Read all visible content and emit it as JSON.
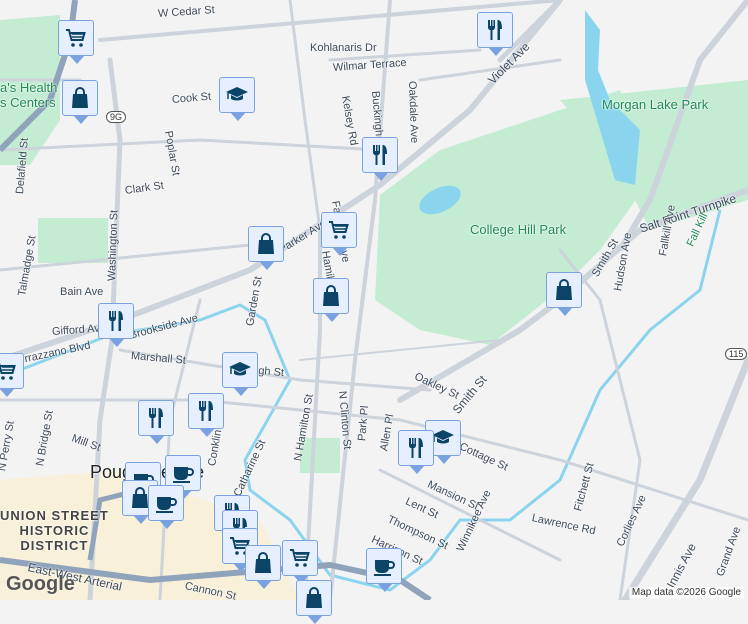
{
  "map": {
    "streets": [
      "W Cedar St",
      "Kohlanaris Dr",
      "Wilmar Terrace",
      "Cook St",
      "Poplar St",
      "Clark St",
      "Delafield St",
      "Washington St",
      "Talmadge St",
      "Bain Ave",
      "Gifford Ave",
      "Brookside Ave",
      "Verrazzano Blvd",
      "Marshall St",
      "Garden St",
      "Parker Ave",
      "N Hamilton St",
      "Fairview Ave",
      "Kelsey Rd",
      "Buckingham",
      "Oakdale Ave",
      "Violet Ave",
      "Salt Point Turnpike",
      "Smith St",
      "Hudson Ave",
      "Fallkill Ave",
      "Oakley St",
      "N Clinton St",
      "Park Pl",
      "Allen Pl",
      "Cottage St",
      "Mansion St",
      "Lent St",
      "Thompson St",
      "Harrison St",
      "Winnikee Ave",
      "Lawrence Rd",
      "Fitchett St",
      "Corlies Ave",
      "Innis Ave",
      "Grand Ave",
      "Mill St",
      "N Bridge St",
      "N Perry St",
      "Conklin St",
      "Catharine St",
      "East-West Arterial",
      "Cannon St",
      "Smith St",
      "Hamilton St",
      "High St"
    ],
    "places": {
      "morgan_lake": "Morgan Lake Park",
      "college_hill": "College Hill Park",
      "fall_kill": "Fall Kill",
      "health": "a's Health\ns Centers",
      "district": "UNION STREET\nHISTORIC\nDISTRICT",
      "city": "Poughkeepsie"
    },
    "route_shields": [
      "9G",
      "115"
    ],
    "markers": [
      "cart-icon",
      "bag-icon",
      "graduation-cap-icon",
      "restaurant-icon",
      "restaurant-icon",
      "cart-icon",
      "bag-icon",
      "bag-icon",
      "bag-icon",
      "restaurant-icon",
      "cart-icon",
      "graduation-cap-icon",
      "restaurant-icon",
      "restaurant-icon",
      "graduation-cap-icon",
      "restaurant-icon",
      "coffee-icon",
      "coffee-icon",
      "bag-icon",
      "coffee-icon",
      "restaurant-icon",
      "restaurant-icon",
      "cart-icon",
      "bag-icon",
      "cart-icon",
      "bag-icon",
      "coffee-icon"
    ],
    "logo": "Google",
    "attribution": "Map data ©2026 Google"
  }
}
